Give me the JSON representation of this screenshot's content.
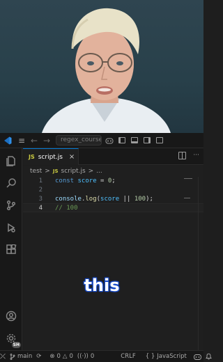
{
  "titlebar": {
    "search_text": "regex_course",
    "menu_glyph": "≡",
    "back_glyph": "←",
    "forward_glyph": "→"
  },
  "tab": {
    "badge": "JS",
    "filename": "script.js",
    "close_glyph": "×",
    "more_glyph": "···"
  },
  "breadcrumb": {
    "folder": "test",
    "sep1": ">",
    "badge": "JS",
    "file": "script.js",
    "sep2": ">",
    "symbol": "..."
  },
  "editor": {
    "lines": [
      {
        "n": "1",
        "tokens": [
          "const",
          " ",
          "score",
          " = ",
          "0",
          ";"
        ]
      },
      {
        "n": "2"
      },
      {
        "n": "3",
        "tokens": [
          "console",
          ".",
          "log",
          "(",
          "score",
          " || ",
          "100",
          ");"
        ]
      },
      {
        "n": "4",
        "tokens": [
          "// 100"
        ]
      }
    ]
  },
  "caption": "this",
  "statusbar": {
    "remote_glyph": "⤫",
    "branch": "main",
    "sync_glyph": "⟳",
    "errors": "0",
    "warnings": "0",
    "ports": "0",
    "line_ending": "CRLF",
    "language_prefix": "{ }",
    "language": "JavaScript"
  },
  "activity": {
    "avatar_badge": "SH"
  },
  "colors": {
    "keyword": "#569cd6",
    "variable": "#4fc1ff",
    "number": "#b5cea8",
    "function": "#dcdcaa",
    "object": "#9cdcfe",
    "comment": "#6a9955",
    "caption_outline": "#1a4fd1",
    "tab_accent": "#0078d4"
  }
}
